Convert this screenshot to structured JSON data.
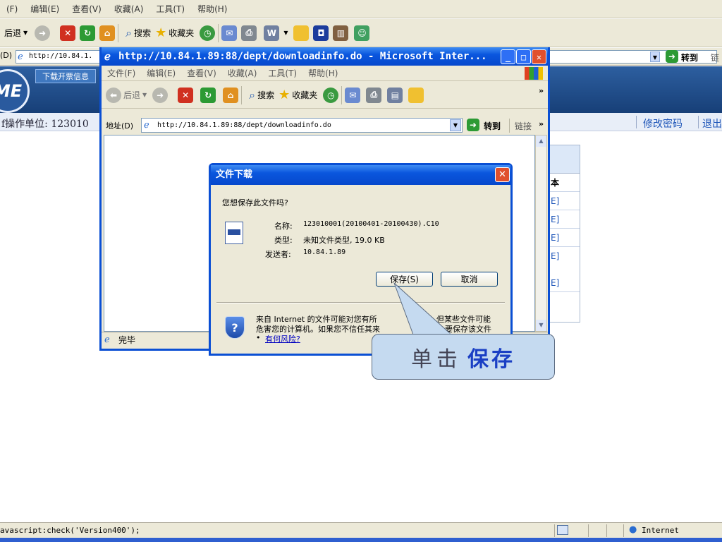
{
  "bg_browser": {
    "menu": [
      "(F)",
      "编辑(E)",
      "查看(V)",
      "收藏(A)",
      "工具(T)",
      "帮助(H)"
    ],
    "toolbar": {
      "back_label": "后退",
      "search_label": "搜索",
      "favorites_label": "收藏夹"
    },
    "address": {
      "label": "(D)",
      "value": "http://10.84.1.",
      "go_label": "转到",
      "links_label": "链"
    },
    "tab_label": "下载开票信息",
    "logo_text": "ME",
    "unit_text": "f操作单位: 123010",
    "change_password": "修改密码",
    "logout": "退出",
    "table": {
      "header": "本",
      "cells": [
        "E]",
        "E]",
        "E]",
        "E]",
        "E]"
      ]
    },
    "status_text": "avascript:check('Version400');",
    "zone_label": "Internet"
  },
  "popup": {
    "title": "http://10.84.1.89:88/dept/downloadinfo.do - Microsoft Inter...",
    "menu": [
      "文件(F)",
      "编辑(E)",
      "查看(V)",
      "收藏(A)",
      "工具(T)",
      "帮助(H)"
    ],
    "toolbar": {
      "back_label": "后退",
      "search_label": "搜索",
      "favorites_label": "收藏夹"
    },
    "address_label": "地址(D)",
    "address_value": "http://10.84.1.89:88/dept/downloadinfo.do",
    "go_label": "转到",
    "links_label": "链接",
    "status_text": "完毕"
  },
  "dialog": {
    "title": "文件下载",
    "question": "您想保存此文件吗?",
    "name_label": "名称:",
    "name_value": "123010001(20100401-20100430).C10",
    "type_label": "类型:",
    "type_value": "未知文件类型, 19.0 KB",
    "from_label": "发送者:",
    "from_value": "10.84.1.89",
    "save_label": "保存(S)",
    "cancel_label": "取消",
    "warning_line1": "来自 Internet 的文件可能对您有所",
    "warning_line1b": "但某些文件可能",
    "warning_line2": "危害您的计算机。如果您不信任其来",
    "warning_line2b": "要保存该文件",
    "risk_link": "有何风险?"
  },
  "callout": {
    "prefix": "单击",
    "emphasis": "保存"
  },
  "colors": {
    "title_blue": "#0a56de",
    "callout_bg": "#c5daf0",
    "emphasis": "#1a3fc4"
  }
}
